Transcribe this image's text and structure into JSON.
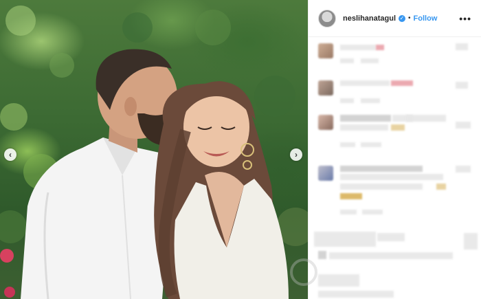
{
  "post": {
    "username": "neslihanatagul",
    "verified_mark": "✓",
    "separator": "•",
    "follow_label": "Follow",
    "more_label": "•••"
  },
  "nav": {
    "prev_label": "‹",
    "next_label": "›"
  },
  "icons": {
    "verified": "verified-badge-icon",
    "more": "more-options-icon",
    "prev": "chevron-left-icon",
    "next": "chevron-right-icon"
  },
  "colors": {
    "accent": "#3897f0",
    "text": "#262626",
    "border": "#efefef"
  }
}
